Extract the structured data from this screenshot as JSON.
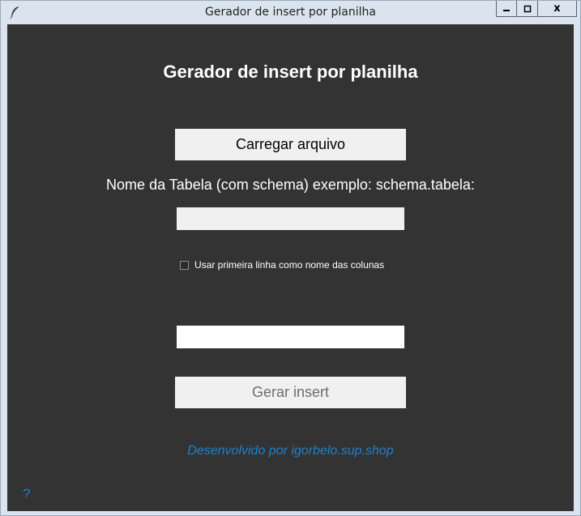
{
  "window": {
    "title": "Gerador de insert por planilha",
    "controls": {
      "minimize": "▁",
      "maximize": "☐",
      "close": "x"
    }
  },
  "main": {
    "heading": "Gerador de insert por planilha",
    "load_button": "Carregar arquivo",
    "table_label": "Nome da Tabela (com schema) exemplo: schema.tabela:",
    "table_input_value": "",
    "checkbox_label": "Usar primeira linha como nome das colunas",
    "checkbox_checked": false,
    "output_value": "",
    "generate_button": "Gerar insert",
    "footer_link": "Desenvolvido por igorbelo.sup.shop",
    "help": "?"
  },
  "colors": {
    "background": "#333333",
    "link": "#1f82c9",
    "button": "#f0f0f0",
    "text": "#ffffff"
  },
  "icons": {
    "app": "feather-icon",
    "checkbox": "checkbox-unchecked-icon"
  }
}
